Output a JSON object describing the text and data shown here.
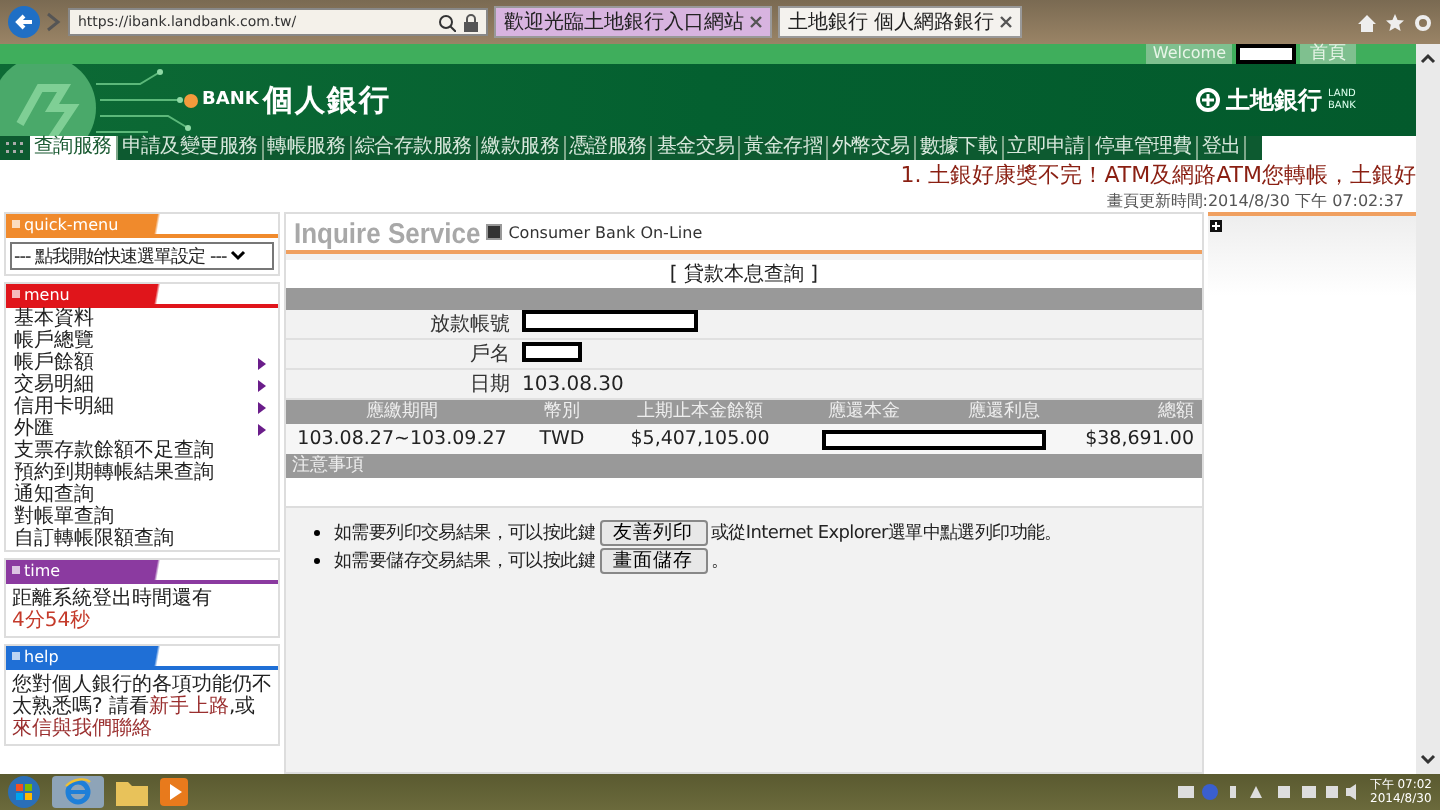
{
  "browser": {
    "url": "https://ibank.landbank.com.tw/",
    "tabs": [
      {
        "title": "歡迎光臨土地銀行入口網站",
        "selected": false
      },
      {
        "title": "土地銀行 個人網路銀行",
        "selected": true
      }
    ]
  },
  "header": {
    "welcome": "Welcome",
    "home_link": "首頁",
    "product_prefix": "BANK",
    "product": "個人銀行",
    "bank_name": "土地銀行",
    "bank_en": "LAND BANK"
  },
  "nav": [
    {
      "label": "查詢服務",
      "selected": true
    },
    {
      "label": "申請及變更服務",
      "selected": false
    },
    {
      "label": "轉帳服務",
      "selected": false
    },
    {
      "label": "綜合存款服務",
      "selected": false
    },
    {
      "label": "繳款服務",
      "selected": false
    },
    {
      "label": "憑證服務",
      "selected": false
    },
    {
      "label": "基金交易",
      "selected": false
    },
    {
      "label": "黃金存摺",
      "selected": false
    },
    {
      "label": "外幣交易",
      "selected": false
    },
    {
      "label": "數據下載",
      "selected": false
    },
    {
      "label": "立即申請",
      "selected": false
    },
    {
      "label": "停車管理費",
      "selected": false
    },
    {
      "label": "登出",
      "selected": false
    }
  ],
  "marquee": "1. 土銀好康獎不完！ATM及網路ATM您轉帳，土銀好",
  "update_time": "畫頁更新時間:2014/8/30 下午 07:02:37",
  "sidebar": {
    "quick_menu": {
      "title": "quick-menu",
      "select": "--- 點我開始快速選單設定 ---"
    },
    "menu": {
      "title": "menu",
      "items": [
        {
          "label": "基本資料",
          "has_submenu": false
        },
        {
          "label": "帳戶總覽",
          "has_submenu": false
        },
        {
          "label": "帳戶餘額",
          "has_submenu": true
        },
        {
          "label": "交易明細",
          "has_submenu": true
        },
        {
          "label": "信用卡明細",
          "has_submenu": true
        },
        {
          "label": "外匯",
          "has_submenu": true
        },
        {
          "label": "支票存款餘額不足查詢",
          "has_submenu": false
        },
        {
          "label": "預約到期轉帳結果查詢",
          "has_submenu": false
        },
        {
          "label": "通知查詢",
          "has_submenu": false
        },
        {
          "label": "對帳單查詢",
          "has_submenu": false
        },
        {
          "label": "自訂轉帳限額查詢",
          "has_submenu": false
        }
      ]
    },
    "time": {
      "title": "time",
      "text": "距離系統登出時間還有",
      "countdown": "4分54秒"
    },
    "help": {
      "title": "help",
      "text_before": "您對個人銀行的各項功能仍不太熟悉嗎? 請看",
      "link_1": "新手上路",
      "text_middle": ",或",
      "link_2": "來信與我們聯絡"
    }
  },
  "main": {
    "banner_title": "Inquire Service",
    "banner_subtitle": "Consumer Bank On-Line",
    "page_title": "[ 貸款本息查詢 ]",
    "fields": [
      {
        "label": "放款帳號",
        "redacted": true
      },
      {
        "label": "戶名",
        "redacted": true
      },
      {
        "label": "日期",
        "value": "103.08.30",
        "redacted": false
      }
    ],
    "table": {
      "columns": [
        "應繳期間",
        "幣別",
        "上期止本金餘額",
        "應還本金",
        "應還利息",
        "總額"
      ],
      "rows": [
        {
          "cells": [
            "103.08.27~103.09.27",
            "TWD",
            "$5,407,105.00",
            null,
            null,
            "$38,691.00"
          ]
        }
      ]
    },
    "notes": {
      "title": "注意事項",
      "items": [
        {
          "text_before": "如需要列印交易結果，可以按此鍵",
          "button": "友善列印",
          "text_after": "或從Internet Explorer選單中點選列印功能。"
        },
        {
          "text_before": "如需要儲存交易結果，可以按此鍵",
          "button": "畫面儲存",
          "text_after": "。"
        }
      ]
    }
  },
  "taskbar": {
    "time": "下午 07:02",
    "date": "2014/8/30"
  }
}
